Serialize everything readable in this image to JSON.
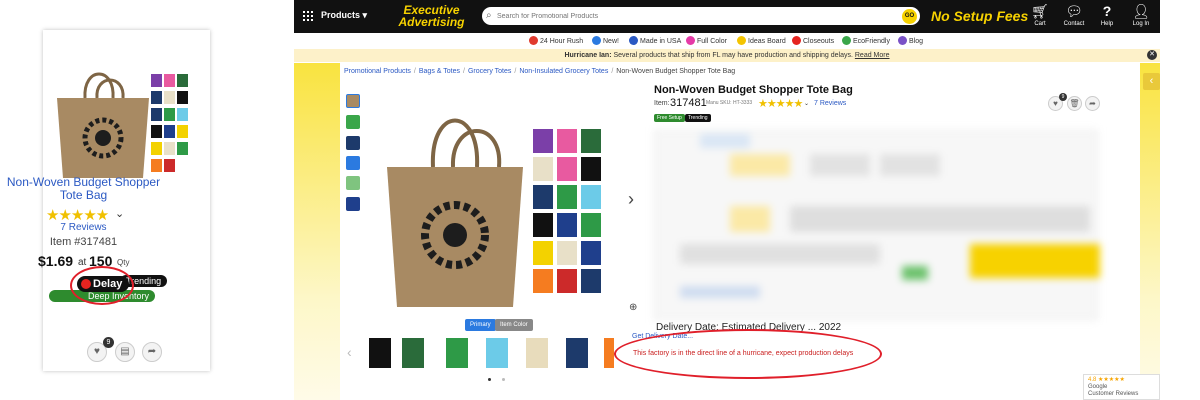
{
  "card": {
    "title": "Non-Woven Budget Shopper Tote Bag",
    "stars": "★★★★★",
    "reviews": "7 Reviews",
    "item": "Item #317481",
    "price": "$1.69",
    "at": "at",
    "min_qty": "150",
    "qty_label": "Qty",
    "badge_delay": "Delay",
    "badge_trending": "Trending",
    "badge_inventory": "Deep Inventory",
    "wishlist_count": "9"
  },
  "topbar": {
    "products_label": "Products ▾",
    "logo_line1": "Executive",
    "logo_line2": "Advertising",
    "search_placeholder": "Search for Promotional Products",
    "go_label": "GO",
    "promo": "No Setup Fees",
    "nav": [
      {
        "icon": "cart-icon",
        "label": "Cart"
      },
      {
        "icon": "contact-icon",
        "label": "Contact"
      },
      {
        "icon": "help-icon",
        "label": "Help"
      },
      {
        "icon": "user-icon",
        "label": "Log In"
      }
    ]
  },
  "subnav": [
    {
      "label": "24 Hour Rush",
      "color": "#e03a2e"
    },
    {
      "label": "New!",
      "color": "#2b7ae0"
    },
    {
      "label": "Made in USA",
      "color": "#2b59c3"
    },
    {
      "label": "Full Color",
      "color": "#e53aa7"
    },
    {
      "label": "Ideas Board",
      "color": "#f4c400"
    },
    {
      "label": "Closeouts",
      "color": "#e52420"
    },
    {
      "label": "EcoFriendly",
      "color": "#3aa64a"
    },
    {
      "label": "Blog",
      "color": "#7a52c7"
    }
  ],
  "notice": {
    "prefix": "Hurricane Ian:",
    "text": " Several products that ship from FL may have production and shipping delays.",
    "link": "Read More"
  },
  "breadcrumb": [
    "Promotional Products",
    "Bags & Totes",
    "Grocery Totes",
    "Non-Insulated Grocery Totes",
    "Non-Woven Budget Shopper Tote Bag"
  ],
  "gallery": {
    "primary_label": "Primary",
    "item_color_label": "Item Color"
  },
  "product": {
    "title": "Non-Woven Budget Shopper Tote Bag",
    "item_label": "Item:",
    "item_number": "317481",
    "sku": "Manu SKU: HT-3333",
    "stars": "★★★★★",
    "reviews": "7 Reviews",
    "tag_free_setup": "Free Setup",
    "tag_trending": "Trending",
    "wish_count": "9",
    "delivery_line": "Delivery Date:  Estimated Delivery ... 2022",
    "delivery_link": "Get Delivery Date...",
    "factory_message": "This factory is in the direct line of a hurricane, expect production delays"
  },
  "google": {
    "rating": "4.8 ★★★★★",
    "brand": "Google",
    "label": "Customer Reviews"
  },
  "colors": {
    "accent_yellow": "#f7d200",
    "link_blue": "#2b59c3",
    "alert_red": "#c91d1d",
    "tote_tan": "#a88a63"
  }
}
